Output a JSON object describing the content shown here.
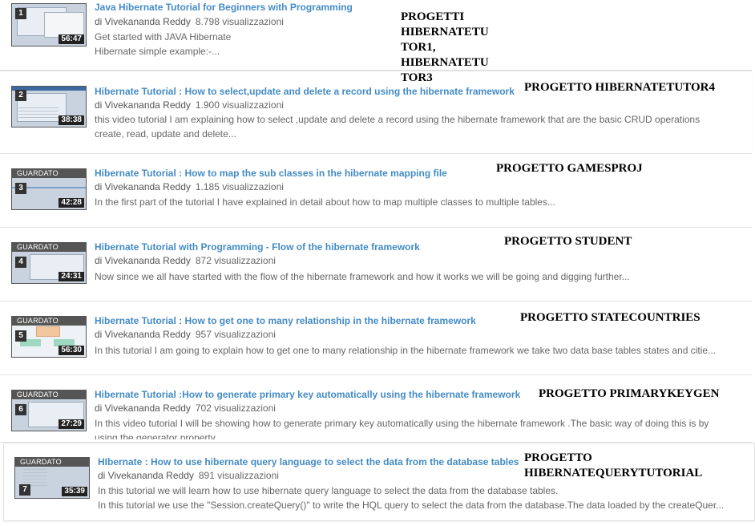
{
  "videos": [
    {
      "index": "1",
      "watched": "",
      "duration": "56:47",
      "title": "Java Hibernate Tutorial for Beginners with Programming",
      "author": "di Vivekananda Reddy",
      "views": "8.798 visualizzazioni",
      "desc1": "Get started with JAVA Hibernate",
      "desc2": "Hibernate simple example:-..."
    },
    {
      "index": "2",
      "watched": "",
      "duration": "38:38",
      "title": "Hibernate Tutorial : How to select,update and delete a record using the hibernate framework",
      "author": "di Vivekananda Reddy",
      "views": "1.900 visualizzazioni",
      "desc1": "this video tutorial I am explaining how to select ,update and delete a record using the hibernate framework that are the basic CRUD operations",
      "desc2": "create, read, update and delete..."
    },
    {
      "index": "3",
      "watched": "GUARDATO",
      "duration": "42:28",
      "title": "Hibernate Tutorial : How to map the sub classes in the hibernate mapping file",
      "author": "di Vivekananda Reddy",
      "views": "1.185 visualizzazioni",
      "desc1": "In the first part of the tutorial I have explained in detail about how to map multiple classes to multiple tables...",
      "desc2": ""
    },
    {
      "index": "4",
      "watched": "GUARDATO",
      "duration": "24:31",
      "title": "Hibernate Tutorial with Programming - Flow of the hibernate framework",
      "author": "di Vivekananda Reddy",
      "views": "872 visualizzazioni",
      "desc1": "Now since we all have started with the flow of the hibernate framework and how it works we will be going and digging further...",
      "desc2": ""
    },
    {
      "index": "5",
      "watched": "GUARDATO",
      "duration": "56:30",
      "title": "Hibernate Tutorial : How to get one to many relationship in the hibernate framework",
      "author": "di Vivekananda Reddy",
      "views": "957 visualizzazioni",
      "desc1": "In this tutorial I am going to explain how to get one to many relationship in the hibernate framework we take two data base tables states and citie...",
      "desc2": ""
    },
    {
      "index": "6",
      "watched": "GUARDATO",
      "duration": "27:29",
      "title": "Hibernate Tutorial :How to generate primary key automatically using the hibernate framework",
      "author": "di Vivekananda Reddy",
      "views": "702 visualizzazioni",
      "desc1": "In this video tutorial I will be showing how to generate primary key automatically using the hibernate framework .The basic way of doing this is by",
      "desc2": "using the generator property..."
    },
    {
      "index": "7",
      "watched": "GUARDATO",
      "duration": "35:39",
      "title": "HIbernate : How to use hibernate query language to select the data from the database tables",
      "author": "di Vivekananda Reddy",
      "views": "891 visualizzazioni",
      "desc1": "In this tutorial we will learn how to use hibernate query language to select the data from the database tables.",
      "desc2": "In this tutorial we use the \"Session.createQuery()\" to write the HQL query to select the data from the database.The data loaded by the createQuer..."
    }
  ],
  "notes": {
    "n1_l1": "PROGETTI",
    "n1_l2": "HIBERNATETU",
    "n1_l3": "TOR1,",
    "n1_l4": "HIBERNATETU",
    "n1_l5": "TOR3",
    "n2": "PROGETTO HIBERNATETUTOR4",
    "n3": "PROGETTO GAMESPROJ",
    "n4": "PROGETTO STUDENT",
    "n5": "PROGETTO STATECOUNTRIES",
    "n6": "PROGETTO PRIMARYKEYGEN",
    "n7_l1": "PROGETTO",
    "n7_l2": "HIBERNATEQUERYTUTORIAL"
  },
  "colors": {
    "link": "#438bc5",
    "watched_band": "#555555",
    "duration_bg": "#222222"
  }
}
